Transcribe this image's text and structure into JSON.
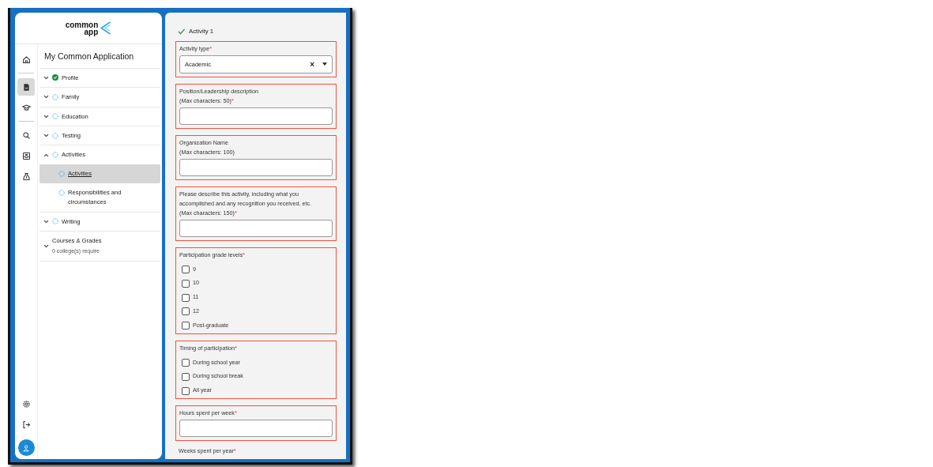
{
  "logo": {
    "lines": [
      "common",
      "app"
    ]
  },
  "rail": {
    "top": [
      {
        "selected": false
      },
      {
        "selected": true
      },
      {
        "selected": false
      },
      {
        "selected": false
      },
      {
        "selected": false
      },
      {
        "selected": false
      }
    ]
  },
  "sidebar": {
    "title": "My Common Application",
    "items": [
      {
        "label": "Profile",
        "kind": "complete",
        "expanded": false
      },
      {
        "label": "Family",
        "kind": "pending",
        "expanded": false
      },
      {
        "label": "Education",
        "kind": "pending",
        "expanded": false
      },
      {
        "label": "Testing",
        "kind": "pending",
        "expanded": false
      },
      {
        "label": "Activities",
        "kind": "pending",
        "expanded": true,
        "children": [
          {
            "label": "Activities",
            "kind": "pending",
            "selected": true
          },
          {
            "label": "Responsibilities and circumstances",
            "kind": "pending",
            "selected": false
          }
        ]
      },
      {
        "label": "Writing",
        "kind": "pending",
        "expanded": false
      },
      {
        "label": "Courses & Grades",
        "kind": "plain",
        "expanded": false,
        "subtitle": "0 college(s) require"
      }
    ]
  },
  "form": {
    "heading": "Activity 1",
    "heading_done": true,
    "fields": [
      {
        "kind": "select",
        "label": "Activity type",
        "required_mark": "*",
        "value": "Academic",
        "clear": "×"
      },
      {
        "kind": "text",
        "label": "Position/Leadership description\n(Max characters: 50)",
        "required_mark": "*"
      },
      {
        "kind": "text",
        "label": "Organization Name\n(Max characters: 100)"
      },
      {
        "kind": "text",
        "label": "Please describe this activity, including what you accomplished and any recognition you received, etc.\n(Max characters: 150)",
        "required_mark": "*"
      },
      {
        "kind": "checks",
        "label": "Participation grade levels",
        "required_mark": "*",
        "options": [
          {
            "label": "9",
            "checked": false
          },
          {
            "label": "10",
            "checked": false
          },
          {
            "label": "11",
            "checked": false
          },
          {
            "label": "12",
            "checked": false
          },
          {
            "label": "Post-graduate",
            "checked": false
          }
        ]
      },
      {
        "kind": "checks",
        "label": "Timing of participation",
        "required_mark": "*",
        "options": [
          {
            "label": "During school year",
            "checked": false
          },
          {
            "label": "During school break",
            "checked": false
          },
          {
            "label": "All year",
            "checked": false
          }
        ]
      },
      {
        "kind": "text",
        "label": "Hours spent per week",
        "required_mark": "*"
      },
      {
        "kind": "cut",
        "label": "Weeks spent per year",
        "required_mark": "*"
      }
    ]
  }
}
